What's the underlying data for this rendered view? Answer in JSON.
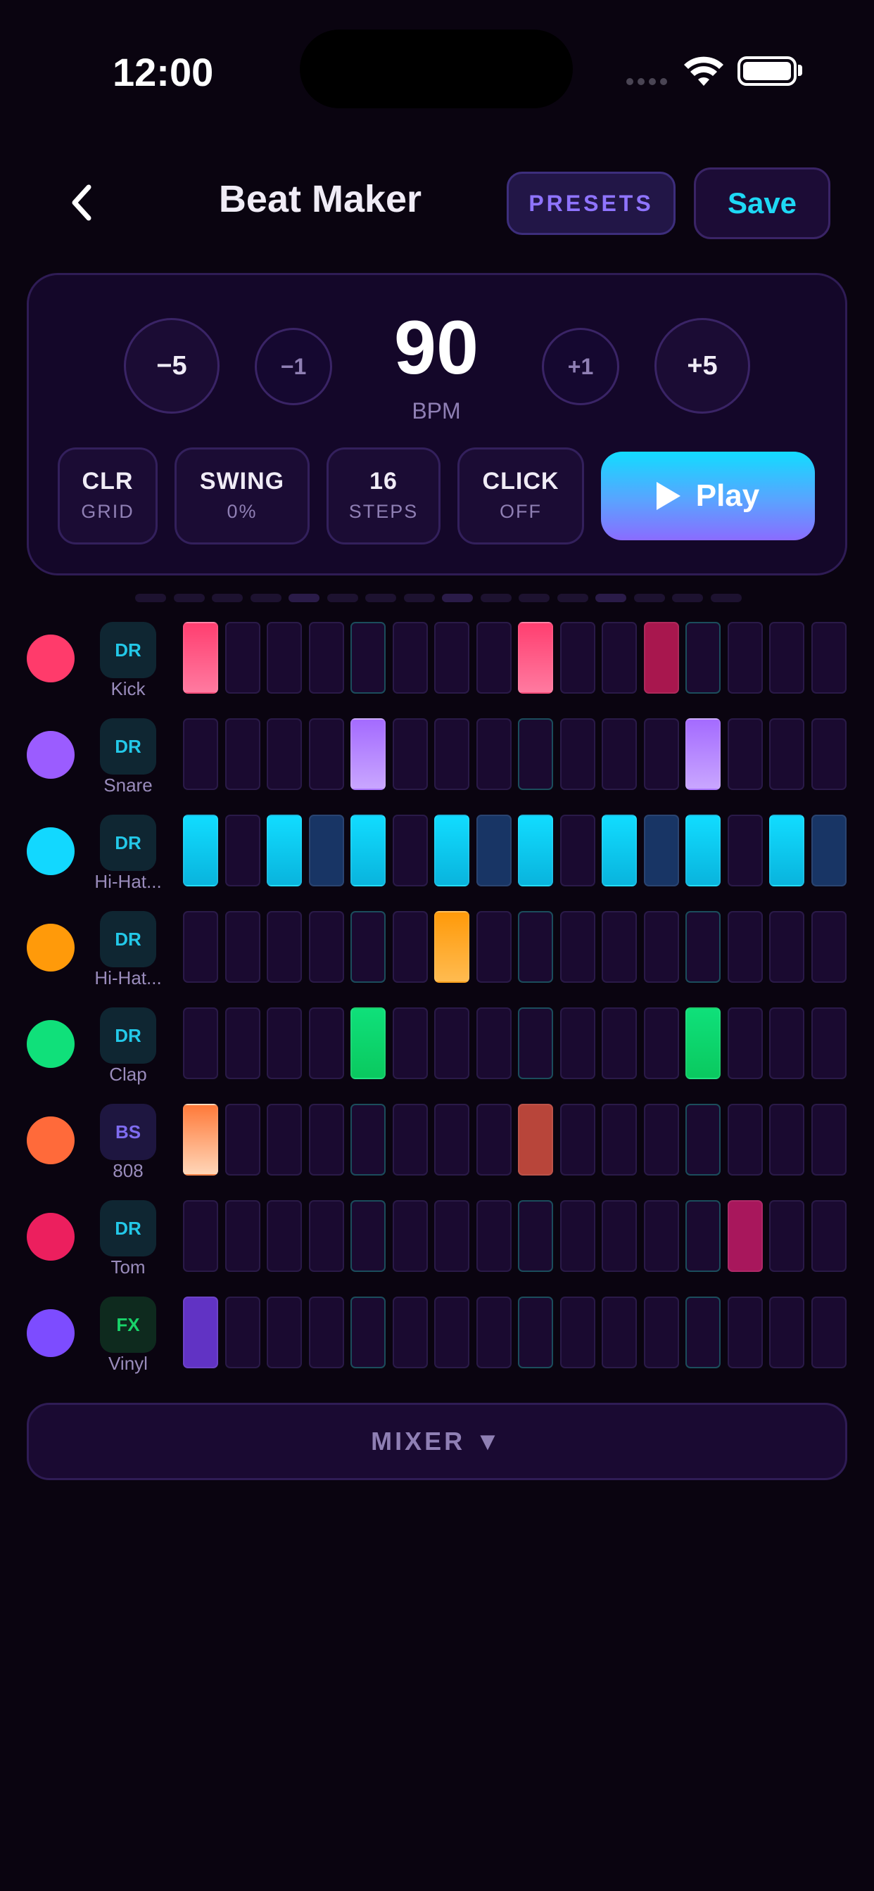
{
  "status": {
    "time": "12:00"
  },
  "header": {
    "title": "Beat Maker",
    "presets_label": "PRESETS",
    "save_label": "Save"
  },
  "transport": {
    "bpm": "90",
    "bpm_unit": "BPM",
    "minus5": "−5",
    "minus1": "−1",
    "plus1": "+1",
    "plus5": "+5",
    "controls": [
      {
        "title": "CLR",
        "sub": "GRID"
      },
      {
        "title": "SWING",
        "sub": "0%"
      },
      {
        "title": "16",
        "sub": "STEPS"
      },
      {
        "title": "CLICK",
        "sub": "OFF"
      }
    ],
    "play_label": "Play"
  },
  "tracks": [
    {
      "name": "Kick",
      "badge": "DR",
      "dot": "#ff3b6b",
      "badge_bg": "#0f2632",
      "badge_color": "#23c8e8",
      "steps": [
        "pink",
        0,
        0,
        0,
        0,
        0,
        0,
        0,
        "pink",
        0,
        0,
        "maroon",
        0,
        0,
        0,
        0
      ]
    },
    {
      "name": "Snare",
      "badge": "DR",
      "dot": "#9b5cff",
      "badge_bg": "#0f2632",
      "badge_color": "#23c8e8",
      "steps": [
        0,
        0,
        0,
        0,
        "violet",
        0,
        0,
        0,
        0,
        0,
        0,
        0,
        "violet",
        0,
        0,
        0
      ]
    },
    {
      "name": "Hi-Hat...",
      "badge": "DR",
      "dot": "#12d8ff",
      "badge_bg": "#0f2632",
      "badge_color": "#23c8e8",
      "steps": [
        "cyan",
        0,
        "cyan",
        "navy",
        "cyan",
        0,
        "cyan",
        "navy",
        "cyan",
        0,
        "cyan",
        "navy",
        "cyan",
        0,
        "cyan",
        "navy"
      ]
    },
    {
      "name": "Hi-Hat...",
      "badge": "DR",
      "dot": "#ff9a0a",
      "badge_bg": "#0f2632",
      "badge_color": "#23c8e8",
      "steps": [
        0,
        0,
        0,
        0,
        0,
        0,
        "orange",
        0,
        0,
        0,
        0,
        0,
        0,
        0,
        0,
        0
      ]
    },
    {
      "name": "Clap",
      "badge": "DR",
      "dot": "#10e07a",
      "badge_bg": "#0f2632",
      "badge_color": "#23c8e8",
      "steps": [
        0,
        0,
        0,
        0,
        "green",
        0,
        0,
        0,
        0,
        0,
        0,
        0,
        "green",
        0,
        0,
        0
      ]
    },
    {
      "name": "808",
      "badge": "BS",
      "dot": "#ff6a3a",
      "badge_bg": "#1e1640",
      "badge_color": "#7f6cf0",
      "steps": [
        "peach",
        0,
        0,
        0,
        0,
        0,
        0,
        0,
        "brick",
        0,
        0,
        0,
        0,
        0,
        0,
        0
      ]
    },
    {
      "name": "Tom",
      "badge": "DR",
      "dot": "#ec1f5e",
      "badge_bg": "#0f2632",
      "badge_color": "#23c8e8",
      "steps": [
        0,
        0,
        0,
        0,
        0,
        0,
        0,
        0,
        0,
        0,
        0,
        0,
        0,
        "magenta",
        0,
        0
      ]
    },
    {
      "name": "Vinyl",
      "badge": "FX",
      "dot": "#7d4cff",
      "badge_bg": "#0e2a1e",
      "badge_color": "#19d46a",
      "steps": [
        "purple",
        0,
        0,
        0,
        0,
        0,
        0,
        0,
        0,
        0,
        0,
        0,
        0,
        0,
        0,
        0
      ]
    }
  ],
  "step_colors": {
    "pink": "linear-gradient(180deg,#ff3f70,#ff7aa0)",
    "maroon": "#a8174e",
    "violet": "linear-gradient(180deg,#a46bff,#c9a6ff)",
    "cyan": "linear-gradient(180deg,#11dcff,#09b4dd)",
    "navy": "#183565",
    "orange": "linear-gradient(180deg,#ff9a0a,#ffbb50)",
    "green": "linear-gradient(180deg,#0fe07a,#0ac95f)",
    "peach": "linear-gradient(180deg,#ff7a3a,#ffd6b8)",
    "brick": "#b8453a",
    "magenta": "#a8175c",
    "purple": "#6133c4"
  },
  "position_indicator": [
    0,
    0,
    0,
    0,
    1,
    0,
    0,
    0,
    1,
    0,
    0,
    0,
    1,
    0,
    0,
    0
  ],
  "mixer_label": "MIXER ▼"
}
